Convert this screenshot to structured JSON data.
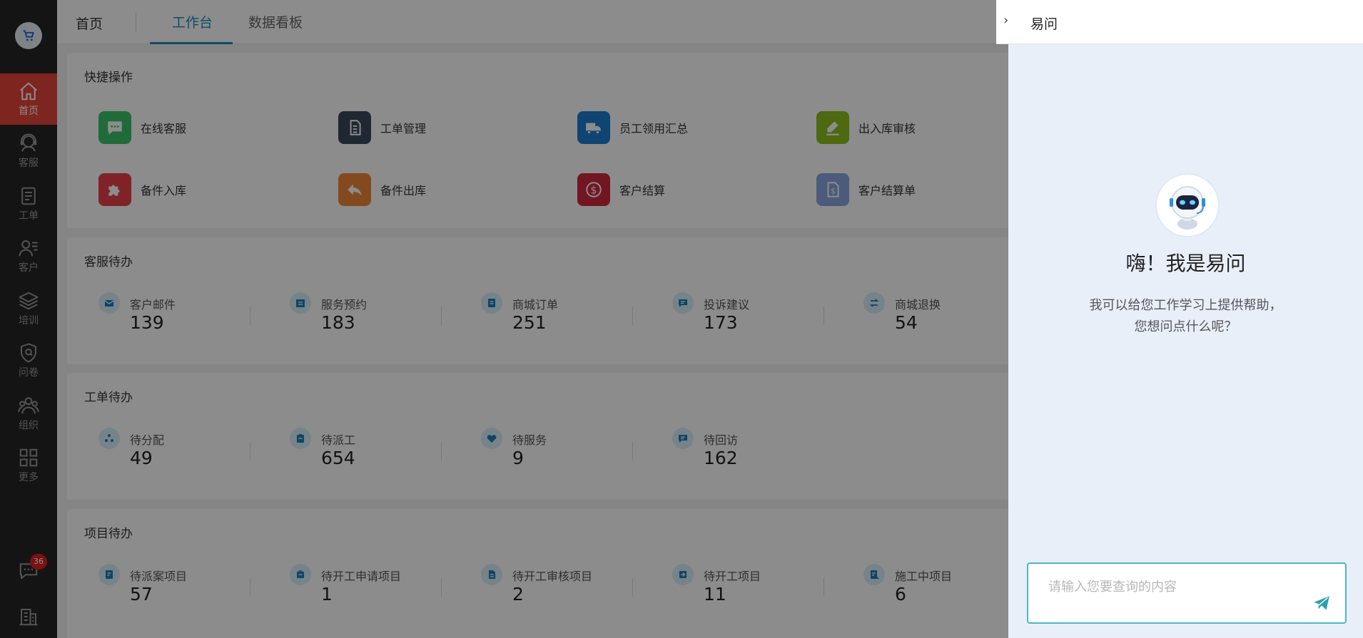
{
  "rail": {
    "logo_icon": "cart-icon",
    "items": [
      {
        "label": "首页",
        "icon": "home-icon",
        "active": true
      },
      {
        "label": "客服",
        "icon": "headset-icon"
      },
      {
        "label": "工单",
        "icon": "ticket-icon"
      },
      {
        "label": "客户",
        "icon": "customer-icon"
      },
      {
        "label": "培训",
        "icon": "layers-icon"
      },
      {
        "label": "问卷",
        "icon": "survey-icon"
      },
      {
        "label": "组织",
        "icon": "team-icon"
      },
      {
        "label": "更多",
        "icon": "grid-icon"
      }
    ],
    "message_badge": "36"
  },
  "topbar": {
    "home": "首页",
    "tabs": [
      {
        "label": "工作台",
        "active": true
      },
      {
        "label": "数据看板"
      }
    ]
  },
  "quick_actions": {
    "title": "快捷操作",
    "items": [
      {
        "label": "在线客服",
        "color": "#3cc46b",
        "icon": "chat-icon"
      },
      {
        "label": "工单管理",
        "color": "#3a4a5c",
        "icon": "document-icon"
      },
      {
        "label": "员工领用汇总",
        "color": "#1a7fd0",
        "icon": "truck-icon"
      },
      {
        "label": "出入库审核",
        "color": "#8cc020",
        "icon": "pen-icon"
      },
      {
        "label": "备件入库",
        "color": "#e8404a",
        "icon": "puzzle-icon"
      },
      {
        "label": "备件出库",
        "color": "#f0883a",
        "icon": "reply-icon"
      },
      {
        "label": "客户结算",
        "color": "#d02840",
        "icon": "dollar-icon"
      },
      {
        "label": "客户结算单",
        "color": "#8aa6e0",
        "icon": "bill-icon"
      }
    ]
  },
  "service_todo": {
    "title": "客服待办",
    "items": [
      {
        "label": "客户邮件",
        "value": "139",
        "icon": "mail-icon"
      },
      {
        "label": "服务预约",
        "value": "183",
        "icon": "calendar-icon"
      },
      {
        "label": "商城订单",
        "value": "251",
        "icon": "order-icon"
      },
      {
        "label": "投诉建议",
        "value": "173",
        "icon": "comment-icon"
      },
      {
        "label": "商城退换",
        "value": "54",
        "icon": "swap-icon"
      }
    ]
  },
  "ticket_todo": {
    "title": "工单待办",
    "items": [
      {
        "label": "待分配",
        "value": "49",
        "icon": "distribute-icon"
      },
      {
        "label": "待派工",
        "value": "654",
        "icon": "clipboard-icon"
      },
      {
        "label": "待服务",
        "value": "9",
        "icon": "heart-icon"
      },
      {
        "label": "待回访",
        "value": "162",
        "icon": "callback-icon"
      }
    ]
  },
  "project_todo": {
    "title": "项目待办",
    "items": [
      {
        "label": "待派案项目",
        "value": "57",
        "icon": "case-icon"
      },
      {
        "label": "待开工申请项目",
        "value": "1",
        "icon": "apply-icon"
      },
      {
        "label": "待开工审核项目",
        "value": "2",
        "icon": "review-icon"
      },
      {
        "label": "待开工项目",
        "value": "11",
        "icon": "start-icon"
      },
      {
        "label": "施工中项目",
        "value": "6",
        "icon": "build-icon"
      }
    ]
  },
  "assistant": {
    "title": "易问",
    "greeting": "嗨！我是易问",
    "desc_line1": "我可以给您工作学习上提供帮助，",
    "desc_line2": "您想问点什么呢？",
    "input_placeholder": "请输入您要查询的内容",
    "accent": "#4ab7c8"
  }
}
